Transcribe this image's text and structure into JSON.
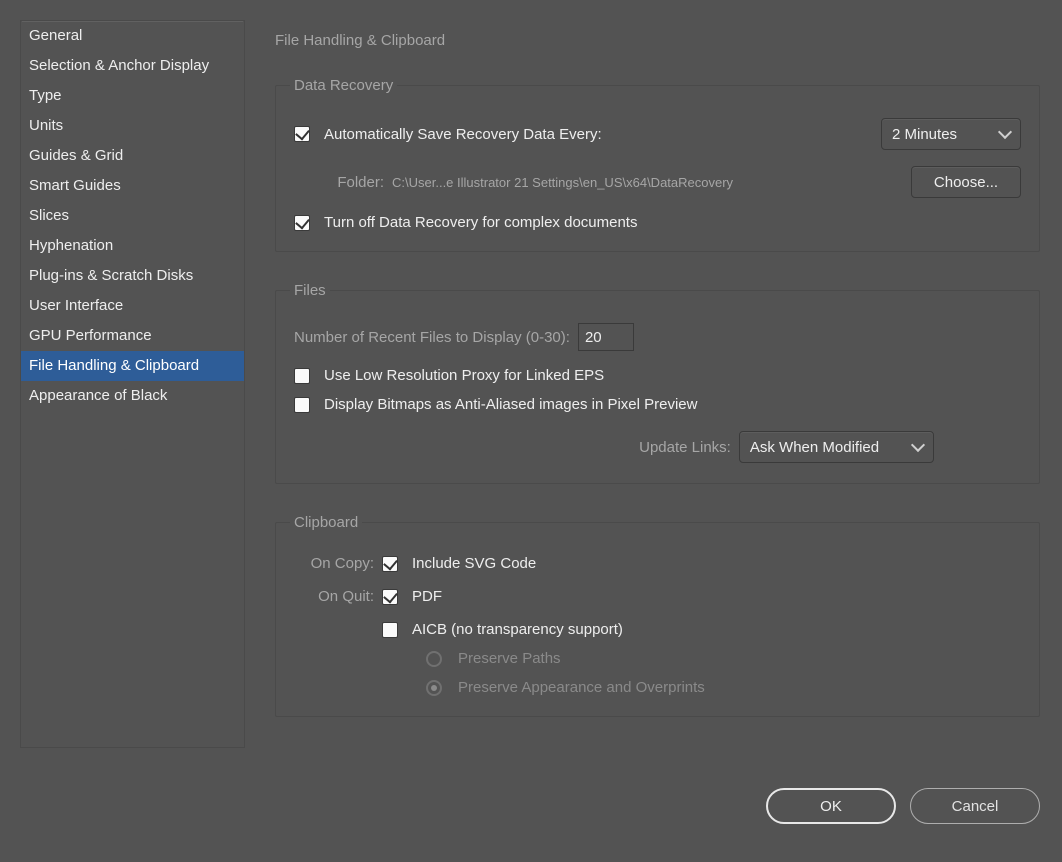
{
  "sidebar": {
    "items": [
      "General",
      "Selection & Anchor Display",
      "Type",
      "Units",
      "Guides & Grid",
      "Smart Guides",
      "Slices",
      "Hyphenation",
      "Plug-ins & Scratch Disks",
      "User Interface",
      "GPU Performance",
      "File Handling & Clipboard",
      "Appearance of Black"
    ],
    "selected_index": 11
  },
  "panel": {
    "title": "File Handling & Clipboard"
  },
  "data_recovery": {
    "legend": "Data Recovery",
    "auto_save_label": "Automatically Save Recovery Data Every:",
    "auto_save_checked": true,
    "interval_value": "2 Minutes",
    "folder_label": "Folder:",
    "folder_path": "C:\\User...e Illustrator 21 Settings\\en_US\\x64\\DataRecovery",
    "choose_label": "Choose...",
    "turn_off_label": "Turn off Data Recovery for complex documents",
    "turn_off_checked": true
  },
  "files": {
    "legend": "Files",
    "recent_label": "Number of Recent Files to Display (0-30):",
    "recent_value": "20",
    "low_res_label": "Use Low Resolution Proxy for Linked EPS",
    "low_res_checked": false,
    "bitmap_label": "Display Bitmaps as Anti-Aliased images in Pixel Preview",
    "bitmap_checked": false,
    "update_links_label": "Update Links:",
    "update_links_value": "Ask When Modified"
  },
  "clipboard": {
    "legend": "Clipboard",
    "on_copy_label": "On Copy:",
    "include_svg_label": "Include SVG Code",
    "include_svg_checked": true,
    "on_quit_label": "On Quit:",
    "pdf_label": "PDF",
    "pdf_checked": true,
    "aicb_label": "AICB (no transparency support)",
    "aicb_checked": false,
    "preserve_paths_label": "Preserve Paths",
    "preserve_appearance_label": "Preserve Appearance and Overprints",
    "aicb_selected_option": "appearance"
  },
  "footer": {
    "ok": "OK",
    "cancel": "Cancel"
  }
}
